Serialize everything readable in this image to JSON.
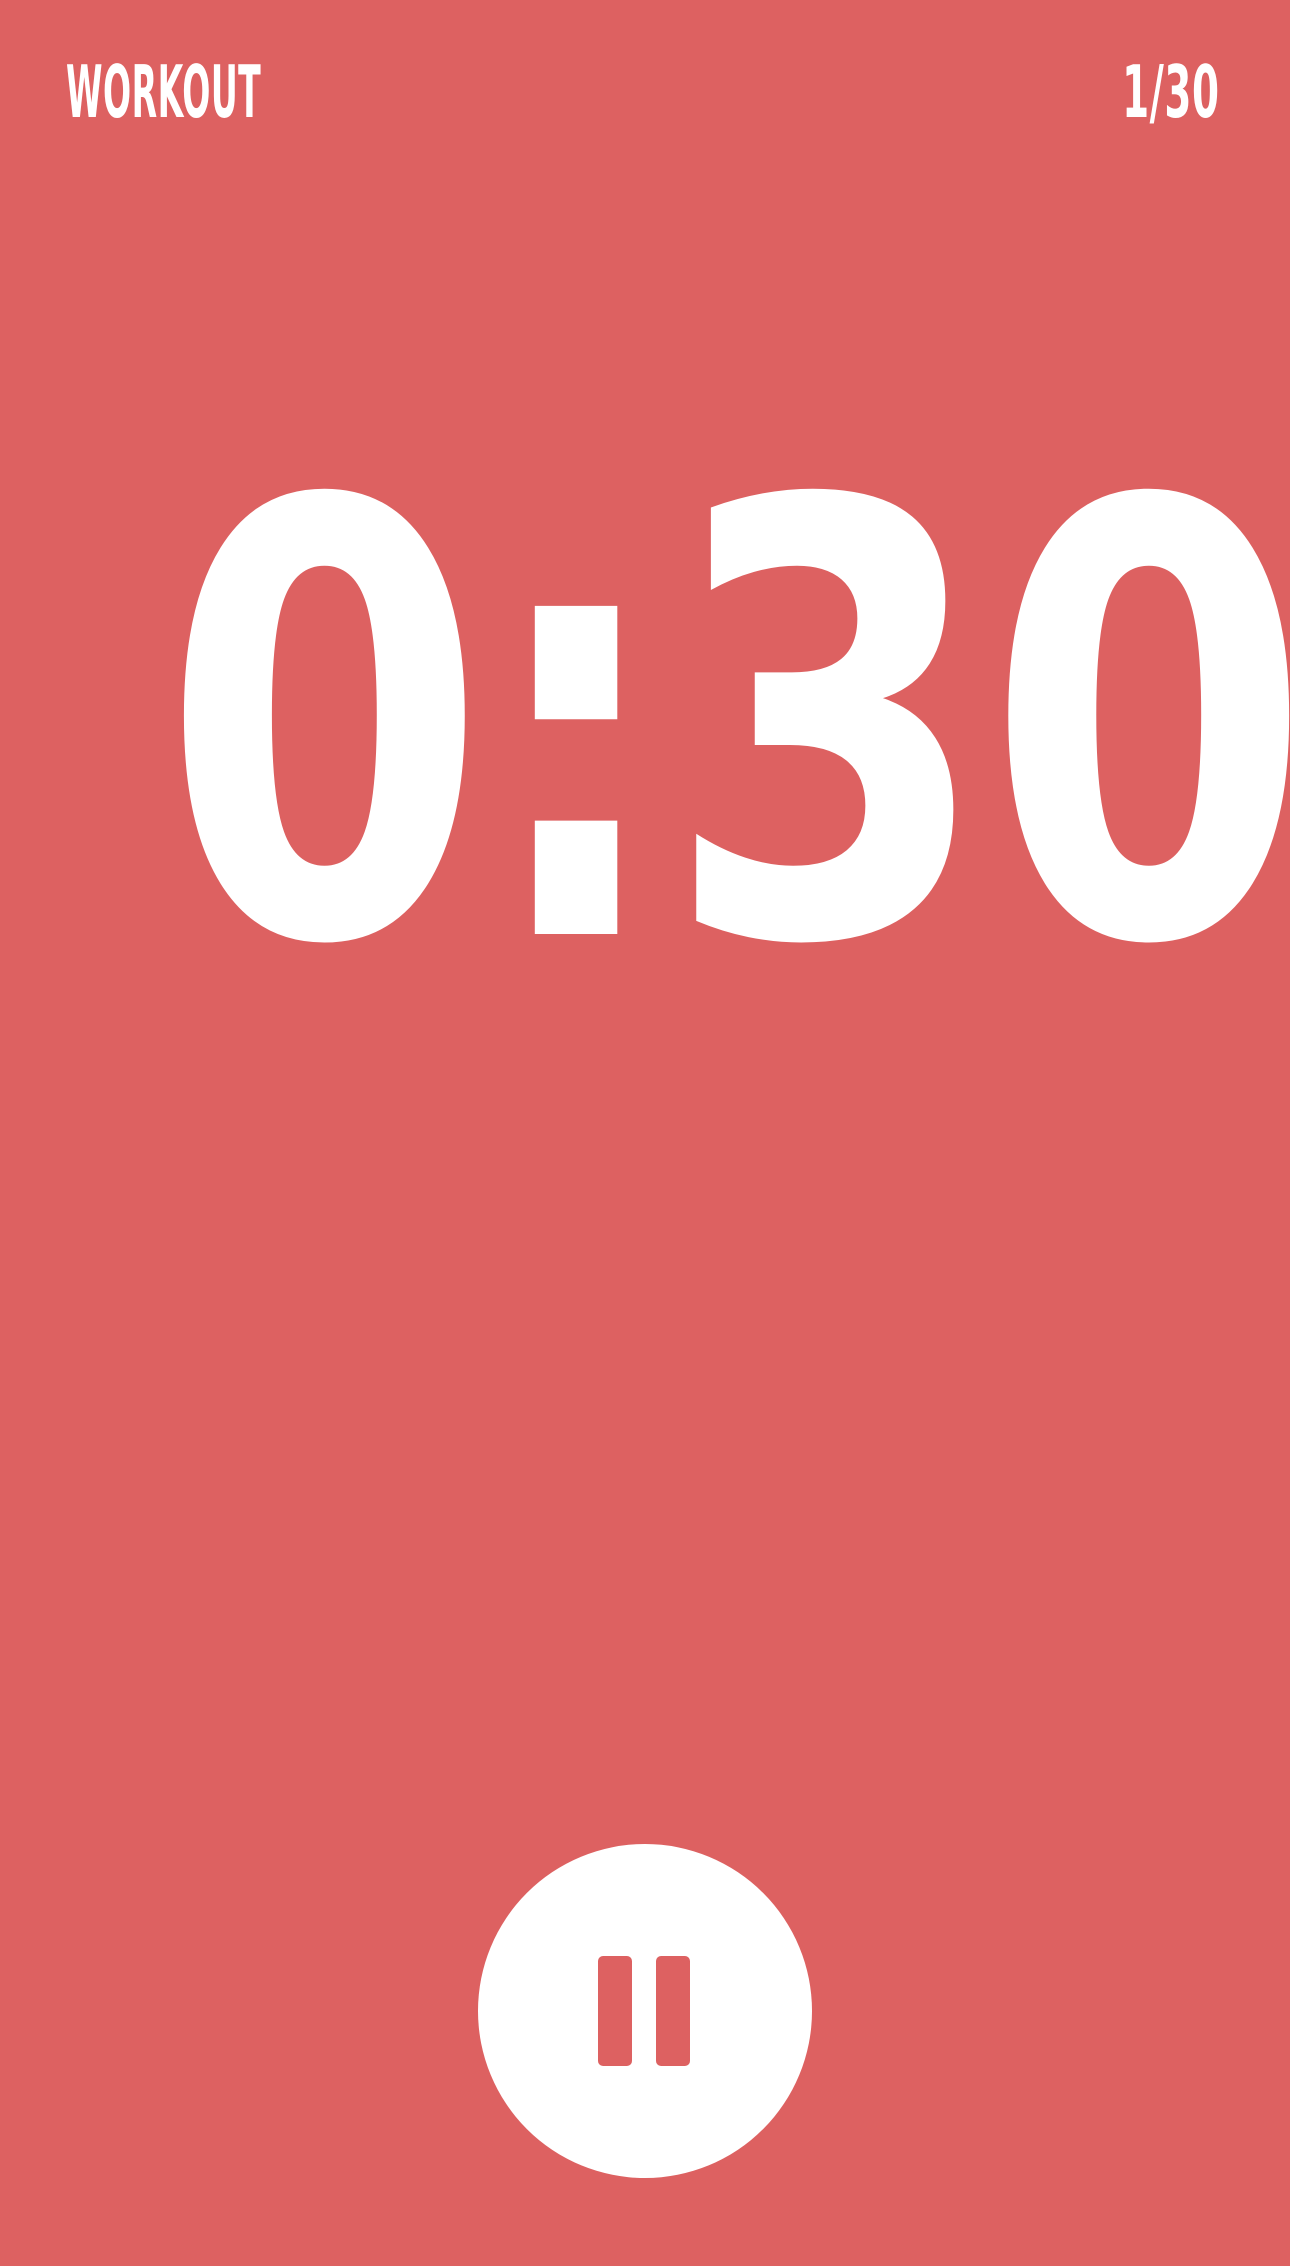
{
  "theme": {
    "background": "#dd6161",
    "foreground": "#ffffff"
  },
  "header": {
    "title": "WORKOUT",
    "progress": "1/30"
  },
  "timer": {
    "value": "0:30"
  },
  "controls": {
    "pause_icon": "pause-icon"
  }
}
